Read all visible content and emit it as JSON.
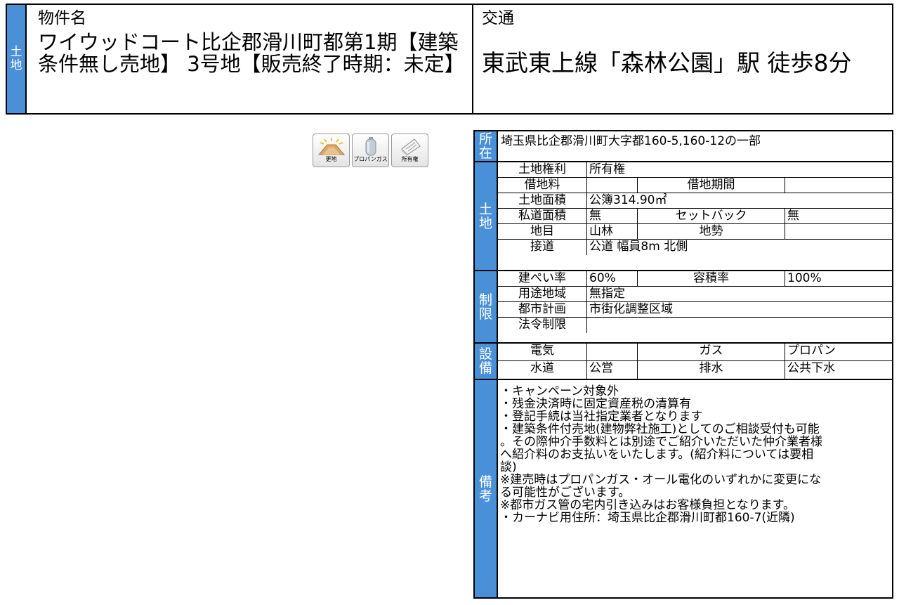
{
  "header": {
    "type_badge": [
      "土",
      "地"
    ],
    "name_label": "物件名",
    "name": "ワイウッドコート比企郡滑川町都第1期【建築条件無し売地】 3号地【販売終了時期：未定】",
    "traffic_label": "交通",
    "traffic": "東武東上線「森林公園」駅 徒歩8分"
  },
  "icons": [
    {
      "name": "更地",
      "icon": "vacant-land-icon"
    },
    {
      "name": "プロパンガス",
      "icon": "propane-gas-icon"
    },
    {
      "name": "所有権",
      "icon": "ownership-icon"
    }
  ],
  "detail": {
    "location": {
      "label": [
        "所",
        "在"
      ],
      "value": "埼玉県比企郡滑川町大字都160-5,160-12の一部"
    },
    "land": {
      "label": [
        "土",
        "地"
      ],
      "rights_label": "土地権利",
      "rights": "所有権",
      "lease_fee_label": "借地料",
      "lease_fee": "",
      "lease_period_label": "借地期間",
      "lease_period": "",
      "area_label": "土地面積",
      "area": "公簿314.90㎡",
      "private_road_label": "私道面積",
      "private_road": "無",
      "setback_label": "セットバック",
      "setback": "無",
      "category_label": "地目",
      "category": "山林",
      "terrain_label": "地勢",
      "terrain": "",
      "road_label": "接道",
      "road": "公道 幅員8m 北側"
    },
    "restrictions": {
      "label": [
        "制",
        "限"
      ],
      "coverage_label": "建ぺい率",
      "coverage": "60%",
      "far_label": "容積率",
      "far": "100%",
      "zoning_label": "用途地域",
      "zoning": "無指定",
      "city_plan_label": "都市計画",
      "city_plan": "市街化調整区域",
      "legal_label": "法令制限",
      "legal": ""
    },
    "facilities": {
      "label": [
        "設",
        "備"
      ],
      "electric_label": "電気",
      "electric": "",
      "gas_label": "ガス",
      "gas": "プロパン",
      "water_label": "水道",
      "water": "公営",
      "drainage_label": "排水",
      "drainage": "公共下水"
    },
    "remarks": {
      "label": [
        "備",
        "考"
      ],
      "lines": [
        "・キャンペーン対象外",
        "・残金決済時に固定資産税の清算有",
        "・登記手続は当社指定業者となります",
        "・建築条件付売地(建物弊社施工)としてのご相談受付も可能",
        "。その際仲介手数料とは別途でご紹介いただいた仲介業者様",
        "へ紹介料のお支払いをいたします。(紹介料については要相",
        "談)",
        "※建売時はプロパンガス・オール電化のいずれかに変更にな",
        "る可能性がございます。",
        "※都市ガス管の宅内引き込みはお客様負担となります。",
        "・カーナビ用住所：埼玉県比企郡滑川町都160-7(近隣)"
      ]
    }
  }
}
